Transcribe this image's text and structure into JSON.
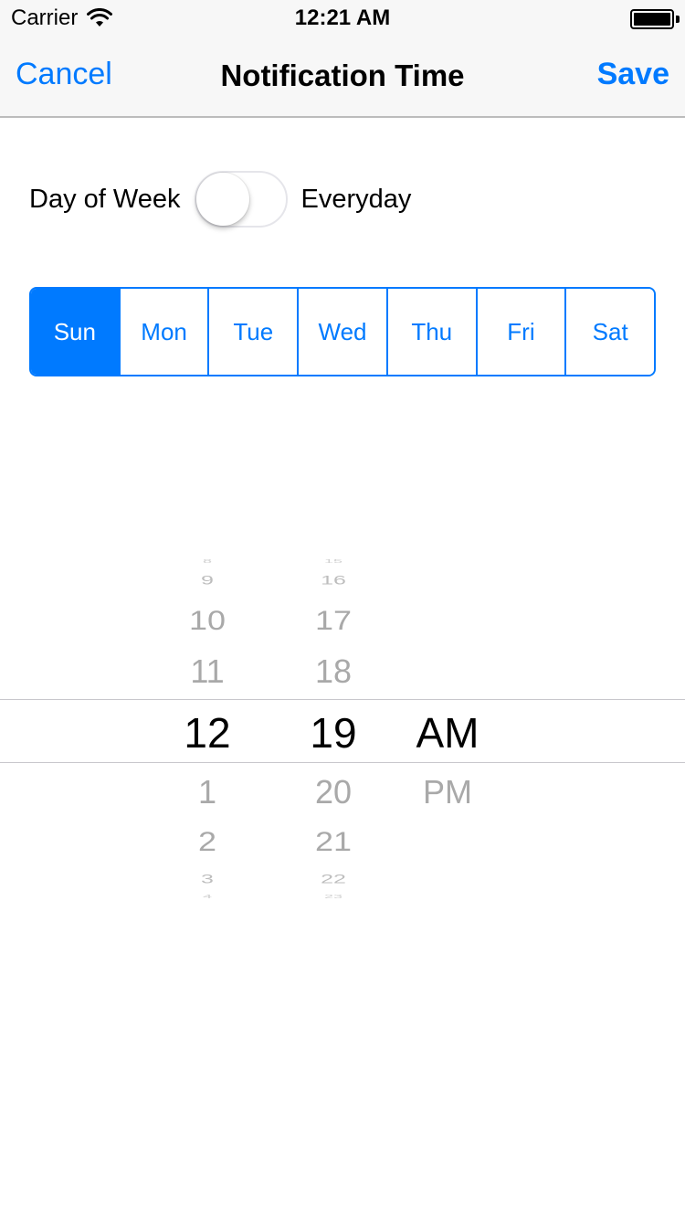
{
  "status_bar": {
    "carrier": "Carrier",
    "time": "12:21 AM",
    "wifi_icon": "wifi-icon",
    "battery_icon": "battery-icon"
  },
  "nav": {
    "cancel": "Cancel",
    "title": "Notification Time",
    "save": "Save"
  },
  "toggle_row": {
    "left_label": "Day of Week",
    "right_label": "Everyday",
    "is_on": false
  },
  "days": {
    "selected": "Sun",
    "items": [
      "Sun",
      "Mon",
      "Tue",
      "Wed",
      "Thu",
      "Fri",
      "Sat"
    ]
  },
  "picker": {
    "hours": {
      "above": [
        "8",
        "9",
        "10",
        "11"
      ],
      "selected": "12",
      "below": [
        "1",
        "2",
        "3",
        "4"
      ]
    },
    "minutes": {
      "above": [
        "15",
        "16",
        "17",
        "18"
      ],
      "selected": "19",
      "below": [
        "20",
        "21",
        "22",
        "23"
      ]
    },
    "ampm": {
      "above": [],
      "selected": "AM",
      "below": [
        "PM"
      ]
    }
  },
  "colors": {
    "accent": "#007aff",
    "bar_background": "#f7f7f7",
    "separator": "#bcbcbc"
  }
}
